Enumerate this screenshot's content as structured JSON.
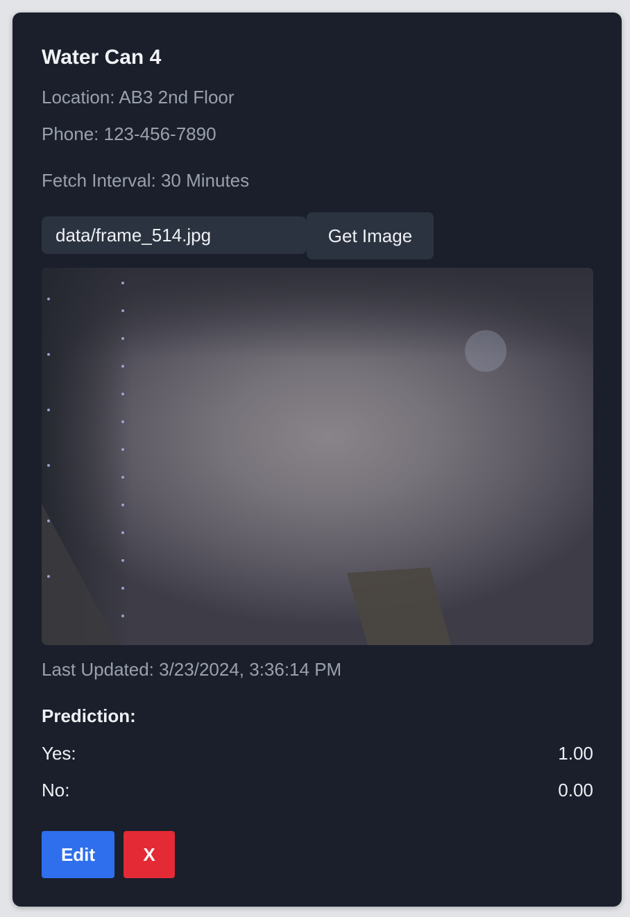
{
  "card": {
    "title": "Water Can 4",
    "location": "Location: AB3 2nd Floor",
    "phone": "Phone: 123-456-7890",
    "fetch_interval": "Fetch Interval: 30 Minutes"
  },
  "fetch": {
    "filename_value": "data/frame_514.jpg",
    "button_label": "Get Image"
  },
  "image": {
    "alt": "camera frame"
  },
  "status": {
    "last_updated": "Last Updated: 3/23/2024, 3:36:14 PM"
  },
  "prediction": {
    "heading": "Prediction:",
    "rows": [
      {
        "label": "Yes:",
        "value": "1.00"
      },
      {
        "label": "No:",
        "value": "0.00"
      }
    ]
  },
  "actions": {
    "edit_label": "Edit",
    "delete_label": "X"
  },
  "colors": {
    "card_bg": "#1a1f2b",
    "primary": "#2f6fee",
    "danger": "#e32a35"
  }
}
